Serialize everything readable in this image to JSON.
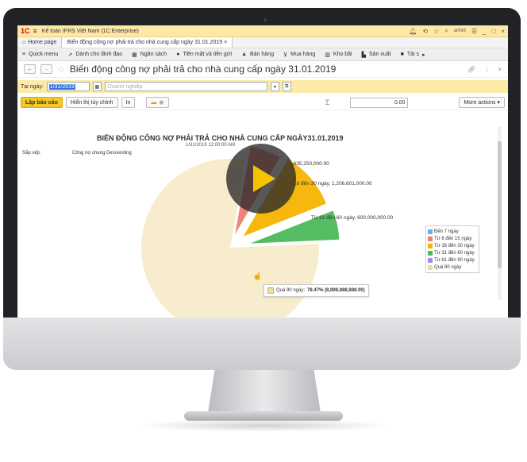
{
  "app": {
    "title": "Kế toán IFRS Việt Nam  (1C:Enterprise)",
    "logo_text": "1C",
    "user": "anhnt"
  },
  "tabs": [
    {
      "label": "Home page"
    },
    {
      "label": "Biến động công nợ phải trả cho nhà cung cấp ngày 31.01.2019 ×"
    }
  ],
  "menu": [
    "Quick menu",
    "Dành cho lãnh đạo",
    "Ngân sách",
    "Tiền mặt và tiền gửi",
    "Bán hàng",
    "Mua hàng",
    "Kho bãi",
    "Sản xuất",
    "Tài s"
  ],
  "form": {
    "title": "Biến động công nợ phải trả cho nhà cung cấp ngày 31.01.2019",
    "date_label": "Tại ngày:",
    "date_value": "1/31/2019",
    "org_placeholder": "Doanh nghiệp",
    "btn_generate": "Lập báo cáo",
    "btn_custom": "Hiển thị tùy chỉnh",
    "btn_print": "In",
    "sum_value": "0.00",
    "more_actions": "More actions"
  },
  "report": {
    "title": "BIẾN ĐỘNG CÔNG NỢ PHẢI TRẢ CHO NHÀ CUNG CẤP NGÀY31.01.2019",
    "subtitle": "1/31/2019 12:00:00 AM",
    "sort_label": "Sắp xếp:",
    "sort_value": "Công nợ chung Descending"
  },
  "chart_data": {
    "type": "pie",
    "title": "BIẾN ĐỘNG CÔNG NỢ PHẢI TRẢ CHO NHÀ CUNG CẤP NGÀY31.01.2019",
    "series": [
      {
        "name": "Đến 7 ngày",
        "value": 0,
        "color": "#5bb7e8"
      },
      {
        "name": "Từ 8 đến 15 ngày",
        "value": 635250000,
        "color": "#ee7f74"
      },
      {
        "name": "Từ 16 đến 30 ngày",
        "value": 1206601000,
        "color": "#f5b400"
      },
      {
        "name": "Từ 31 đến 60 ngày",
        "value": 600000000,
        "color": "#4db85c"
      },
      {
        "name": "Từ 61 đến 90 ngày",
        "value": 0,
        "color": "#9c8ee8"
      },
      {
        "name": "Quá 90 ngày",
        "value": 8898888888,
        "color": "#f1dca0"
      }
    ],
    "labels": [
      ", 635,250,000.00",
      "16 đến 30 ngày, 1,206,601,000.00",
      "Từ 31 đến 60 ngày, 600,000,000.00"
    ],
    "tooltip": {
      "label": "Quá 90 ngày: ",
      "value": "78.47% (8,898,888,888.00)",
      "color": "#f1dca0"
    },
    "legend_position": "right"
  }
}
